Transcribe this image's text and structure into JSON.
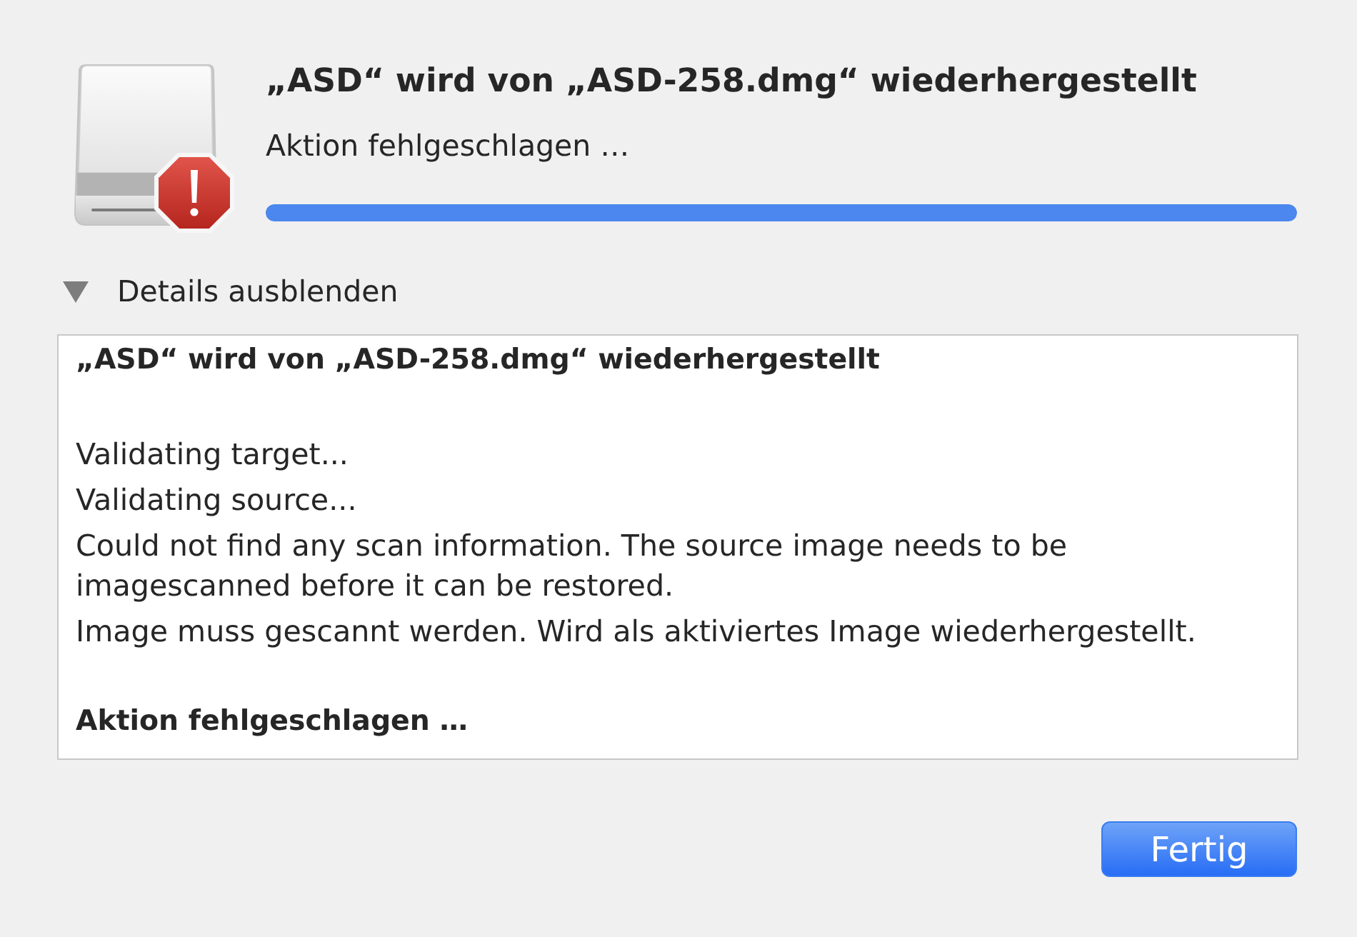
{
  "dialog": {
    "title": "„ASD“ wird von „ASD-258.dmg“ wiederhergestellt",
    "status": "Aktion fehlgeschlagen …",
    "progress": {
      "level": 1
    }
  },
  "details": {
    "label": "Details ausblenden",
    "expanded": true,
    "log": [
      {
        "kind": "heading",
        "text": "„ASD“ wird von „ASD-258.dmg“ wiederhergestellt"
      },
      {
        "kind": "line",
        "text": "Validating target..."
      },
      {
        "kind": "line",
        "text": "Validating source..."
      },
      {
        "kind": "line",
        "text": "Could not find any scan information. The source image needs to be imagescanned before it can be restored."
      },
      {
        "kind": "line",
        "text": "Image muss gescannt werden. Wird als aktiviertes Image wiederhergestellt."
      },
      {
        "kind": "result",
        "text": "Aktion fehlgeschlagen …"
      }
    ]
  },
  "buttons": [
    {
      "label": "Fertig",
      "kind": "primary"
    }
  ]
}
